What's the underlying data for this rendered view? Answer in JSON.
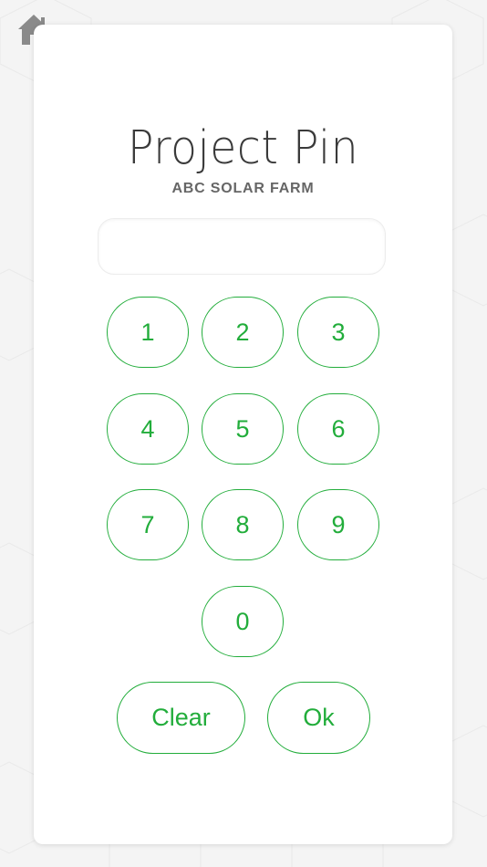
{
  "header": {
    "home_icon": "home-icon"
  },
  "pin_screen": {
    "title": "Project Pin",
    "subtitle": "ABC SOLAR FARM",
    "pin_value": "",
    "keys": {
      "k1": "1",
      "k2": "2",
      "k3": "3",
      "k4": "4",
      "k5": "5",
      "k6": "6",
      "k7": "7",
      "k8": "8",
      "k9": "9",
      "k0": "0"
    },
    "clear_label": "Clear",
    "ok_label": "Ok"
  },
  "colors": {
    "accent": "#22ad3b",
    "title_text": "#3a3a3a",
    "subtitle_text": "#666666",
    "background": "#f4f4f4",
    "card": "#ffffff",
    "home_icon": "#8a8a8a"
  }
}
